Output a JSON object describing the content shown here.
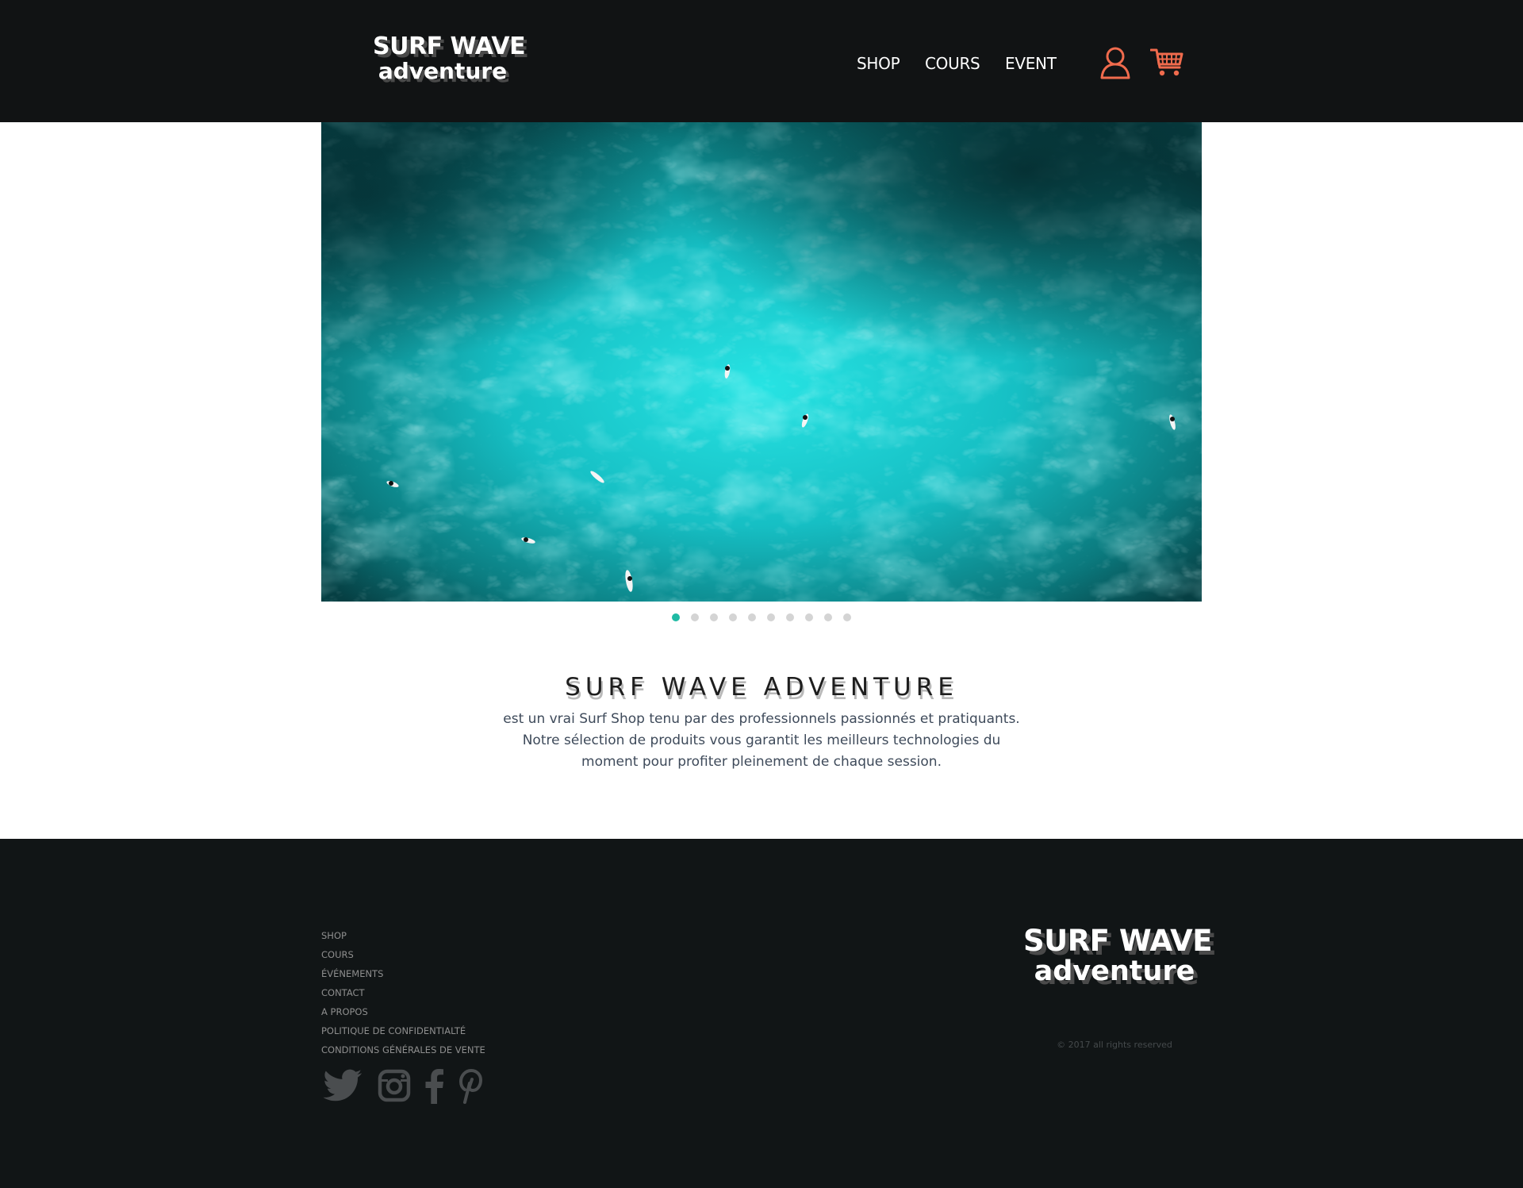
{
  "header": {
    "logo": {
      "line1": "SURF WAVE",
      "line2": "adventure"
    },
    "nav": [
      "SHOP",
      "COURS",
      "EVENT"
    ],
    "icons": [
      "user-icon",
      "cart-icon"
    ],
    "icon_color": "#f06b4d"
  },
  "hero": {
    "slide_count": 10,
    "active_slide": 1,
    "active_dot_color": "#1fbaa4"
  },
  "intro": {
    "title": "SURF WAVE ADVENTURE",
    "lines": [
      "est un vrai Surf Shop tenu par des professionnels passionnés et pratiquants.",
      "Notre sélection de produits vous garantit les meilleurs technologies du",
      "moment pour profiter pleinement de chaque session."
    ]
  },
  "footer": {
    "links": [
      "SHOP",
      "COURS",
      "ÉVÉNEMENTS",
      "CONTACT",
      "A PROPOS",
      "POLITIQUE DE CONFIDENTIALTÉ",
      "CONDITIONS GÉNÉRALES DE VENTE"
    ],
    "social": [
      "twitter-icon",
      "instagram-icon",
      "facebook-icon",
      "pinterest-icon"
    ],
    "logo": {
      "line1": "SURF WAVE",
      "line2": "adventure"
    },
    "copyright": "© 2017 all rights reserved"
  },
  "colors": {
    "header_bg": "#111314",
    "footer_bg": "#111516",
    "accent": "#f06b4d",
    "teal": "#1fbaa4"
  }
}
